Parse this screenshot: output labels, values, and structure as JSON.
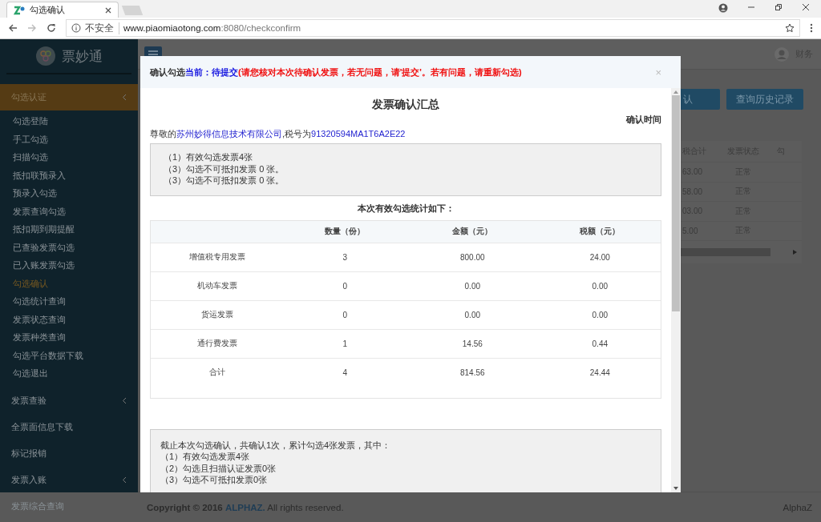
{
  "browser": {
    "tabs": [
      {
        "title": "勾选确认",
        "selected": true
      }
    ],
    "address": {
      "security": "不安全",
      "host": "www.piaomiaotong.com",
      "path": ":8080/checkconfirm"
    }
  },
  "sidebar": {
    "logo_text": "票妙通",
    "items": [
      {
        "kind": "group",
        "label": "勾选认证",
        "expanded": true,
        "children": [
          {
            "label": "勾选登陆",
            "selected": false
          },
          {
            "label": "手工勾选",
            "selected": false
          },
          {
            "label": "扫描勾选",
            "selected": false
          },
          {
            "label": "抵扣联预录入",
            "selected": false
          },
          {
            "label": "预录入勾选",
            "selected": false
          },
          {
            "label": "发票查询勾选",
            "selected": false
          },
          {
            "label": "抵扣期到期提醒",
            "selected": false
          },
          {
            "label": "已查验发票勾选",
            "selected": false
          },
          {
            "label": "已入账发票勾选",
            "selected": false
          },
          {
            "label": "勾选确认",
            "selected": true
          },
          {
            "label": "勾选统计查询",
            "selected": false
          },
          {
            "label": "发票状态查询",
            "selected": false
          },
          {
            "label": "发票种类查询",
            "selected": false
          },
          {
            "label": "勾选平台数据下载",
            "selected": false
          },
          {
            "label": "勾选退出",
            "selected": false
          }
        ]
      },
      {
        "kind": "group",
        "label": "发票查验",
        "expanded": false
      },
      {
        "kind": "link",
        "label": "全票面信息下载"
      },
      {
        "kind": "link",
        "label": "标记报销"
      },
      {
        "kind": "group",
        "label": "发票入账",
        "expanded": false
      },
      {
        "kind": "link",
        "label": "发票综合查询"
      }
    ]
  },
  "header": {
    "user": "财务"
  },
  "actions": [
    "认",
    "查询历史记录"
  ],
  "background_table": {
    "columns": [
      "税合计",
      "发票状态",
      "勾"
    ],
    "rows": [
      [
        "63.00",
        "正常"
      ],
      [
        "58.00",
        "正常"
      ],
      [
        "03.00",
        "正常"
      ],
      [
        "5.00",
        "正常"
      ]
    ]
  },
  "modal": {
    "heading": {
      "prefix": "确认勾选",
      "current": "当前：",
      "status": "待提交",
      "note": "(请您核对本次待确认发票，若无问题，请'提交'。若有问题，请重新勾选)",
      "close": "×"
    },
    "title": "发票确认汇总",
    "confirm_time_label": "确认时间",
    "greeting": {
      "prefix": "尊敬的",
      "company": "苏州妙得信息技术有限公司",
      "middle": ",税号为",
      "tax_id": "91320594MA1T6A2E22"
    },
    "summary": [
      "（1）有效勾选发票4张",
      "（3）勾选不可抵扣发票 0 张。",
      "（3）勾选不可抵扣发票 0 张。"
    ],
    "stats_title": "本次有效勾选统计如下：",
    "table": {
      "columns": [
        "数量（份）",
        "金额（元）",
        "税额（元）"
      ],
      "rows": [
        {
          "name": "增值税专用发票",
          "cells": [
            "3",
            "800.00",
            "24.00"
          ]
        },
        {
          "name": "机动车发票",
          "cells": [
            "0",
            "0.00",
            "0.00"
          ]
        },
        {
          "name": "货运发票",
          "cells": [
            "0",
            "0.00",
            "0.00"
          ]
        },
        {
          "name": "通行费发票",
          "cells": [
            "1",
            "14.56",
            "0.44"
          ]
        },
        {
          "name": "合计",
          "cells": [
            "4",
            "814.56",
            "24.44"
          ]
        }
      ]
    },
    "cumulative": [
      "截止本次勾选确认，共确认1次，累计勾选4张发票，其中：",
      "（1）有效勾选发票4张",
      "（2）勾选且扫描认证发票0张",
      "（3）勾选不可抵扣发票0张"
    ]
  },
  "footer": {
    "copyright": "Copyright © 2016",
    "brand": "ALPHAZ.",
    "rights": "All rights reserved.",
    "right_text": "AlphaZ"
  }
}
